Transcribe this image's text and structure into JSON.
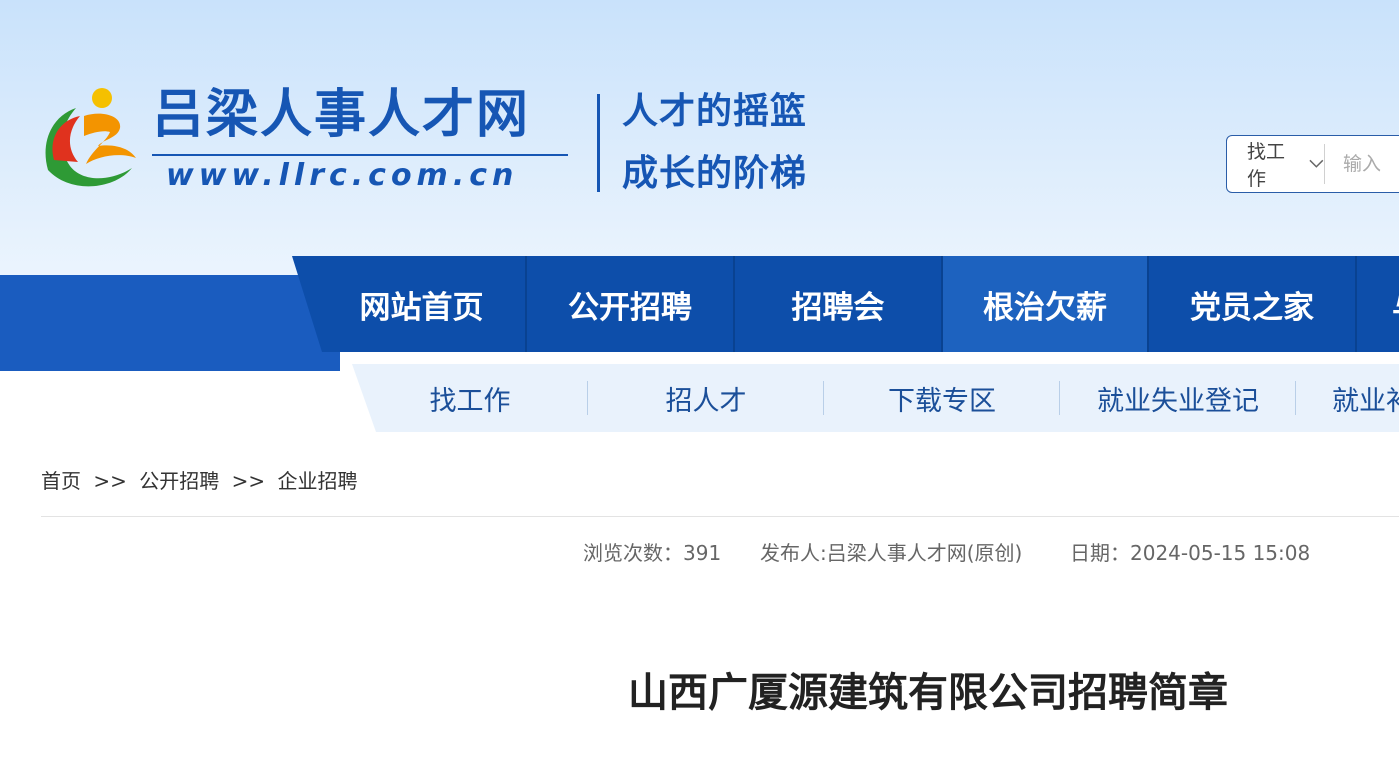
{
  "header": {
    "site_name": "吕梁人事人才网",
    "site_url": "www.llrc.com.cn",
    "slogan_line1": "人才的摇篮",
    "slogan_line2": "成长的阶梯"
  },
  "search": {
    "type_selected": "找工作",
    "placeholder": "输入"
  },
  "nav": {
    "items": [
      {
        "label": "网站首页"
      },
      {
        "label": "公开招聘"
      },
      {
        "label": "招聘会"
      },
      {
        "label": "根治欠薪"
      },
      {
        "label": "党员之家"
      },
      {
        "label": "与"
      }
    ]
  },
  "subnav": {
    "items": [
      {
        "label": "找工作"
      },
      {
        "label": "招人才"
      },
      {
        "label": "下载专区"
      },
      {
        "label": "就业失业登记"
      },
      {
        "label": "就业补"
      }
    ]
  },
  "breadcrumb": {
    "items": [
      "首页",
      "公开招聘",
      "企业招聘"
    ],
    "separator": ">>"
  },
  "article": {
    "views": "浏览次数：391",
    "publisher": "发布人:吕梁人事人才网(原创)",
    "date": "日期：2024-05-15 15:08",
    "title": "山西广厦源建筑有限公司招聘简章"
  },
  "colors": {
    "brand_blue": "#1656b4",
    "nav_blue": "#0d4eaa",
    "nav_active": "#1d62bf",
    "subnav_bg": "#e9f2fc"
  }
}
